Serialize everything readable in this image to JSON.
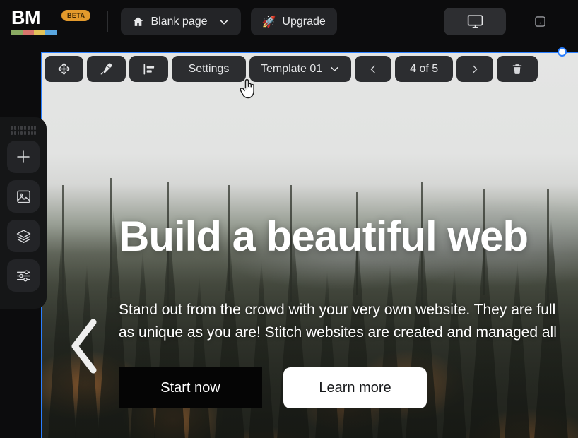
{
  "header": {
    "brand": {
      "text": "BM",
      "badge": "BETA",
      "stripe_colors": [
        "#8aab62",
        "#d9756c",
        "#e3c35a",
        "#5aa7e0"
      ]
    },
    "page_button": {
      "label": "Blank page",
      "icon": "home-icon",
      "chevron": "chevron-down-icon"
    },
    "upgrade_button": {
      "label": "Upgrade",
      "icon": "rocket-icon",
      "emoji": "🚀"
    },
    "devices": [
      {
        "name": "desktop",
        "icon": "monitor-icon",
        "active": true
      },
      {
        "name": "mobile",
        "icon": "mobile-icon",
        "active": false
      }
    ]
  },
  "element_toolbar": {
    "move": {
      "name": "move-icon",
      "label": ""
    },
    "paint": {
      "name": "paint-roller-icon",
      "label": ""
    },
    "align": {
      "name": "align-left-icon",
      "label": ""
    },
    "settings_label": "Settings",
    "template_label": "Template 01",
    "template_chevron": "chevron-down-icon",
    "prev_icon": "chevron-left-icon",
    "counter_label": "4 of 5",
    "next_icon": "chevron-right-icon",
    "delete_icon": "trash-icon"
  },
  "rail": {
    "grip": "drag-dots-handle",
    "items": [
      {
        "name": "add-icon",
        "label": "Add"
      },
      {
        "name": "image-icon",
        "label": "Media"
      },
      {
        "name": "layers-icon",
        "label": "Layers"
      },
      {
        "name": "sliders-icon",
        "label": "Settings"
      }
    ]
  },
  "hero": {
    "title": "Build a beautiful web",
    "subtitle_line1": "Stand out from the crowd with your very own website. They are full",
    "subtitle_line2": "as unique as you are! Stitch websites are created and managed all",
    "primary_button": "Start now",
    "secondary_button": "Learn more",
    "carousel_prev_icon": "chevron-left-icon"
  },
  "selection": {
    "border_color": "#2a7fff",
    "handle": "resize-handle-top-right"
  },
  "cursor": {
    "name": "pointer-hand-cursor"
  }
}
